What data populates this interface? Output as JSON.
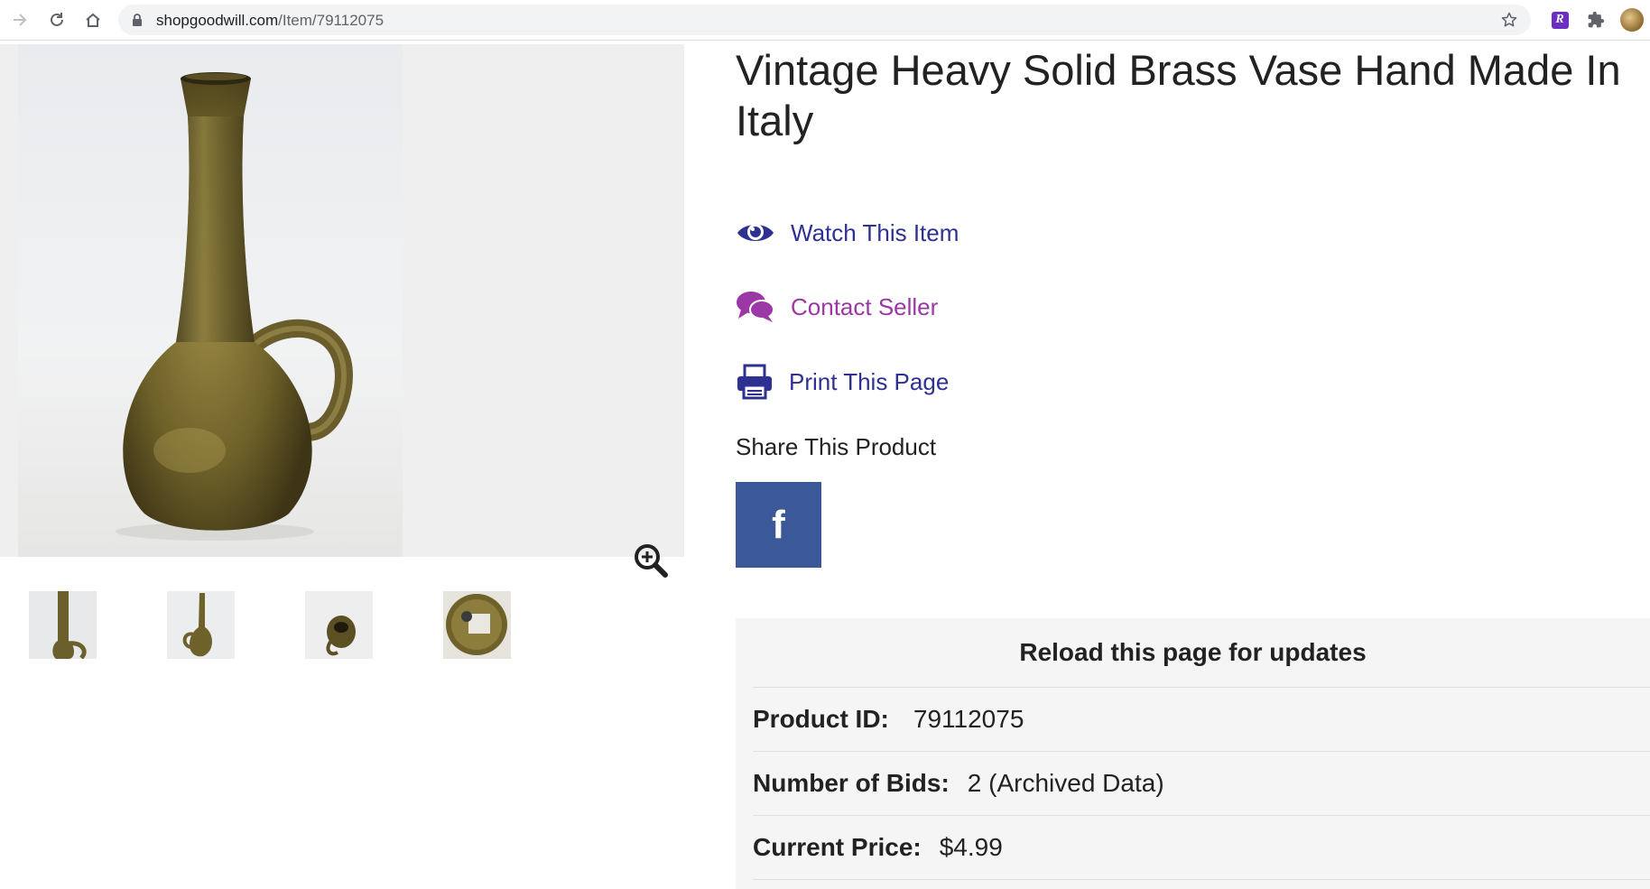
{
  "browser": {
    "url_host": "shopgoodwill.com",
    "url_path": "/Item/79112075",
    "icons": {
      "forward": "forward-arrow-icon",
      "reload": "reload-icon",
      "home": "home-icon",
      "lock": "lock-icon",
      "bookmark": "star-icon",
      "extension_r": "r-extension-icon",
      "extensions": "puzzle-icon",
      "profile": "avatar"
    },
    "extension_r_letter": "R"
  },
  "product": {
    "title": "Vintage Heavy Solid Brass Vase Hand Made In Italy",
    "gallery": {
      "zoom_icon": "zoom-in-icon",
      "thumbnail_count": 4
    }
  },
  "actions": {
    "watch": {
      "label": "Watch This Item",
      "icon": "eye-icon",
      "color": "#2e3192"
    },
    "contact": {
      "label": "Contact Seller",
      "icon": "chat-bubbles-icon",
      "color": "#9b38a6"
    },
    "print": {
      "label": "Print This Page",
      "icon": "printer-icon",
      "color": "#2e3192"
    }
  },
  "share": {
    "heading": "Share This Product",
    "facebook_glyph": "f",
    "facebook_color": "#3b5998"
  },
  "info": {
    "reload_message": "Reload this page for updates",
    "rows": [
      {
        "label": "Product ID:",
        "value": "79112075"
      },
      {
        "label": "Number of Bids:",
        "value": "2 (Archived Data)"
      },
      {
        "label": "Current Price:",
        "value": "$4.99"
      }
    ]
  }
}
